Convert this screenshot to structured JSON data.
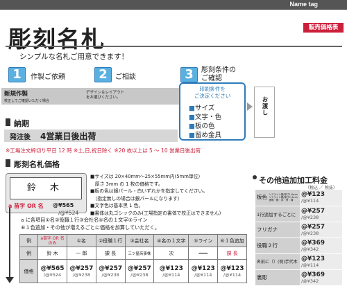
{
  "header": {
    "tag": "Name tag",
    "title": "彫刻名札",
    "price_button": "販売価格表"
  },
  "intro": "シンプルな名札ご用意できます！",
  "steps": [
    {
      "num": "1",
      "label": "作製ご依頼"
    },
    {
      "num": "2",
      "label": "ご相談"
    },
    {
      "num": "3",
      "label": "彫刻条件の\nご確認"
    }
  ],
  "flow": {
    "new": "新規作製",
    "new_sub": "校正してご確認いただく場合",
    "design": "デザイン＆レイアウト\nをお選びください。",
    "cond_title": "印刷条件を\nご決定ください",
    "cond_items": [
      "サイズ",
      "文字・色",
      "板の色",
      "留め金具"
    ],
    "deliver": "お渡し"
  },
  "delivery": {
    "heading": "納期",
    "badge": "発注後",
    "text": "4営業日後出荷",
    "note": "※工場注文締切り平日 12 時 ※土,日,祝日除く ※20 枚以上は 5 ～ 10 営業日後出荷"
  },
  "pricing": {
    "heading": "彫刻名札価格",
    "sample_name": "鈴 木",
    "sample_label": "a 苗字 OR 名",
    "sample_price": "@¥565",
    "sample_price2": "/@¥524",
    "specs": [
      "■サイズは 20×40mm～25×55mm内(5mm単位）",
      "　厚さ 3mm の 1 枚の価格です。",
      "■板の色は銀パール・白いずれかを指定してください。",
      "　（指定無しの場合は銀パールになります）",
      "■文字色は基本黒 1 色。",
      "■書体は丸ゴシックのみ(工場指定の書体で校正はできません)"
    ],
    "options_line1": "a に各項目①名②役職１行③会社名④名の１文字⑤ライン",
    "options_line2": "⑥１色追加・その他が増えるごとに価格を加算していただく。",
    "table": {
      "row_ex": "例",
      "row_price": "価格",
      "headers": [
        "a苗字 OR 名\nのみ",
        "①名",
        "②役職１行",
        "③会社名",
        "④名の１文字",
        "⑤ライン",
        "⑥１色追加"
      ],
      "examples": [
        "鈴 木",
        "一 郎",
        "課 長",
        "三ツ星商事株",
        "次",
        "━━━",
        "課 長"
      ],
      "prices": [
        "@¥565",
        "@¥257",
        "@¥257",
        "@¥257",
        "@¥123",
        "@¥123",
        "@¥123"
      ],
      "prices2": [
        "/@¥524",
        "/@¥238",
        "/@¥238",
        "/@¥238",
        "/@¥114",
        "/@¥114",
        "/@¥114"
      ]
    }
  },
  "side": {
    "title": "その他追加加工料金",
    "tax": "（税込 ／ 税抜）",
    "rows": [
      {
        "label": "板色",
        "note": "ヘアライン銀/厚さ1.6mm\nヘアライン銀/厚さ2.4mm\n透明・銀・赤・青・緑",
        "price": "@¥123",
        "price2": "/@¥114"
      },
      {
        "label": "1行追加するごとに",
        "note": "",
        "price": "@¥257",
        "price2": "/@¥238"
      },
      {
        "label": "フリガナ",
        "note": "",
        "price": "@¥257",
        "price2": "/@¥238"
      },
      {
        "label": "役職２行",
        "note": "",
        "price": "@¥369",
        "price2": "/@¥342"
      },
      {
        "label": "名前に（）(例)手代木",
        "note": "",
        "price": "@¥123",
        "price2": "/@¥114"
      },
      {
        "label": "裏彫",
        "note": "",
        "price": "@¥369",
        "price2": "/@¥342"
      }
    ]
  },
  "colors": {
    "accent_blue": "#2e7bb8",
    "accent_red": "#cc1f3a"
  }
}
